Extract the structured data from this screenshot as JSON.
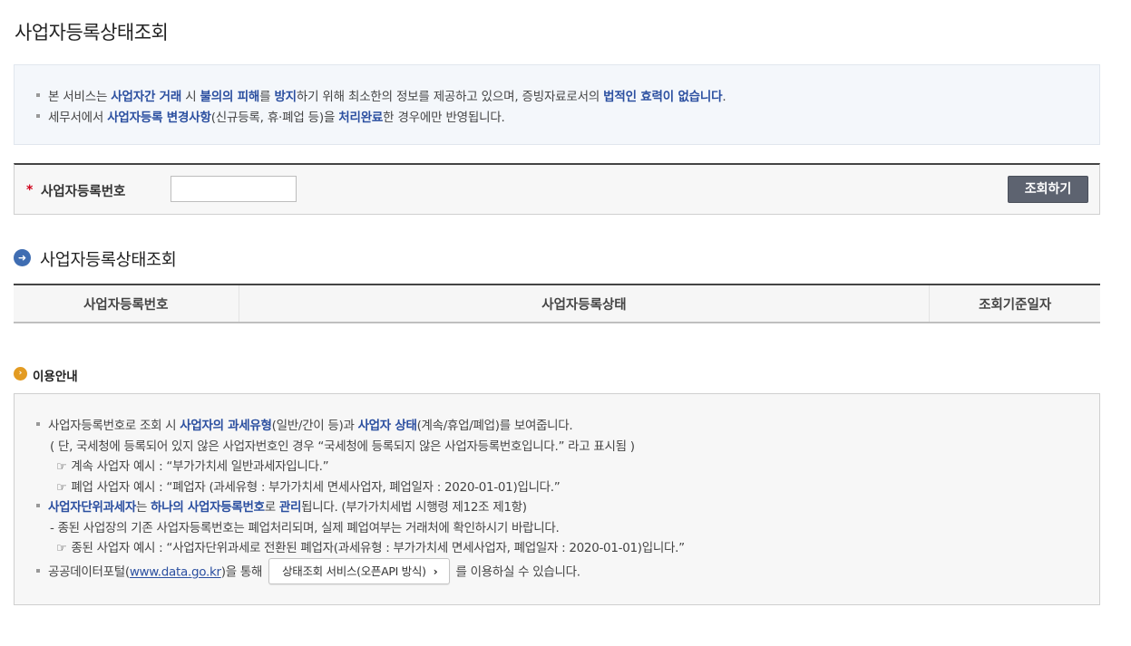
{
  "page": {
    "title": "사업자등록상태조회"
  },
  "notice": {
    "line1": [
      "본 서비스는 ",
      "사업자간 거래",
      " 시 ",
      "불의의 피해",
      "를 ",
      "방지",
      "하기 위해 최소한의 정보를 제공하고 있으며, 증빙자료로서의 ",
      "법적인 효력이 없습니다",
      "."
    ],
    "line2": [
      "세무서에서 ",
      "사업자등록 변경사항",
      "(신규등록, 휴·폐업 등)을 ",
      "처리완료",
      "한 경우에만 반영됩니다."
    ]
  },
  "search": {
    "required_mark": "*",
    "label": "사업자등록번호",
    "input_value": "",
    "button_label": "조회하기"
  },
  "result": {
    "section_title": "사업자등록상태조회",
    "columns": [
      "사업자등록번호",
      "사업자등록상태",
      "조회기준일자"
    ]
  },
  "guide": {
    "title": "이용안내",
    "l1": [
      "사업자등록번호로 조회 시 ",
      "사업자의 과세유형",
      "(일반/간이 등)과 ",
      "사업자 상태",
      "(계속/휴업/폐업)를 보여줍니다."
    ],
    "l2": "( 단, 국세청에 등록되어 있지 않은 사업자번호인 경우 “국세청에 등록되지 않은 사업자등록번호입니다.” 라고 표시됨 )",
    "l3_icon": "☞",
    "l3": "계속 사업자 예시 : “부가가치세 일반과세자입니다.”",
    "l4_icon": "☞",
    "l4": "폐업 사업자 예시 : “폐업자 (과세유형 : 부가가치세 면세사업자, 폐업일자 : 2020-01-01)입니다.”",
    "l5": [
      "사업자단위과세자",
      "는 ",
      "하나의 사업자등록번호",
      "로 ",
      "관리",
      "됩니다. (부가가치세법 시행령 제12조 제1항)"
    ],
    "l6": "- 종된 사업장의 기존 사업자등록번호는 폐업처리되며, 실제 폐업여부는 거래처에 확인하시기 바랍니다.",
    "l7_icon": "☞",
    "l7": "종된 사업자 예시 : “사업자단위과세로 전환된 폐업자(과세유형 : 부가가치세 면세사업자, 폐업일자 : 2020-01-01)입니다.”",
    "l8_prefix": "공공데이터포털(",
    "l8_link": "www.data.go.kr",
    "l8_mid": ")을 통해",
    "api_button": "상태조회 서비스(오픈API 방식)",
    "api_chevron": "›",
    "l8_suffix": "를 이용하실 수 있습니다."
  }
}
